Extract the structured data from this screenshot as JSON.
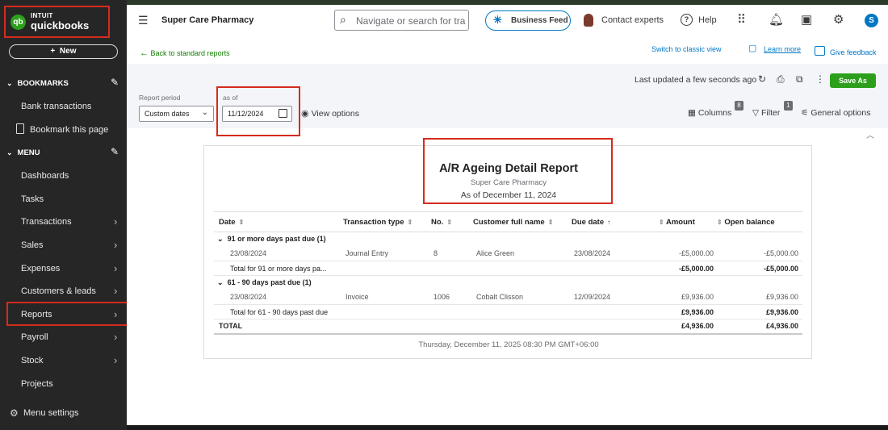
{
  "brand": {
    "intuit": "INTUIT",
    "product": "quickbooks",
    "accent": "#2ca01c",
    "highlight": "#d52b1e"
  },
  "sidebar": {
    "new_label": "New",
    "bookmarks_header": "BOOKMARKS",
    "bookmarks": [
      {
        "label": "Bank transactions"
      },
      {
        "label": "Bookmark this page"
      }
    ],
    "menu_header": "MENU",
    "items": [
      {
        "label": "Dashboards",
        "has_arrow": false
      },
      {
        "label": "Tasks",
        "has_arrow": false
      },
      {
        "label": "Transactions",
        "has_arrow": true
      },
      {
        "label": "Sales",
        "has_arrow": true
      },
      {
        "label": "Expenses",
        "has_arrow": true
      },
      {
        "label": "Customers & leads",
        "has_arrow": true
      },
      {
        "label": "Reports",
        "has_arrow": true
      },
      {
        "label": "Payroll",
        "has_arrow": true
      },
      {
        "label": "Stock",
        "has_arrow": true
      },
      {
        "label": "Projects",
        "has_arrow": false
      }
    ],
    "settings_label": "Menu settings"
  },
  "topbar": {
    "company": "Super Care Pharmacy",
    "search_placeholder": "Navigate or search for transactions",
    "business_feed": "Business Feed",
    "contact_experts": "Contact experts",
    "help": "Help",
    "user_initial": "S"
  },
  "links": {
    "back": "Back to standard reports",
    "classic": "Switch to classic view",
    "learn_more": "Learn more",
    "feedback": "Give feedback"
  },
  "options": {
    "last_updated": "Last updated a few seconds ago",
    "save_as": "Save As",
    "report_period_label": "Report period",
    "report_period_value": "Custom dates",
    "as_of_label": "as of",
    "as_of_value": "11/12/2024",
    "view_options": "View options",
    "columns": "Columns",
    "columns_badge": "8",
    "filter": "Filter",
    "filter_badge": "1",
    "general_options": "General options"
  },
  "report": {
    "title": "A/R Ageing Detail Report",
    "company": "Super Care Pharmacy",
    "as_of": "As of December 11, 2024",
    "columns": [
      "Date",
      "Transaction type",
      "No.",
      "Customer full name",
      "Due date",
      "Amount",
      "Open balance"
    ],
    "groups": [
      {
        "name": "91 or more days past due (1)",
        "rows": [
          {
            "date": "23/08/2024",
            "type": "Journal Entry",
            "no": "8",
            "customer": "Alice Green",
            "due": "23/08/2024",
            "amount": "-£5,000.00",
            "balance": "-£5,000.00"
          }
        ],
        "total_label": "Total for 91 or more days pa...",
        "total_amount": "-£5,000.00",
        "total_balance": "-£5,000.00"
      },
      {
        "name": "61 - 90 days past due (1)",
        "rows": [
          {
            "date": "23/08/2024",
            "type": "Invoice",
            "no": "1006",
            "customer": "Cobalt Clisson",
            "due": "12/09/2024",
            "amount": "£9,936.00",
            "balance": "£9,936.00"
          }
        ],
        "total_label": "Total for 61 - 90 days past due",
        "total_amount": "£9,936.00",
        "total_balance": "£9,936.00"
      }
    ],
    "grand_total_label": "TOTAL",
    "grand_total_amount": "£4,936.00",
    "grand_total_balance": "£4,936.00",
    "footer": "Thursday, December 11, 2025 08:30 PM GMT+06:00"
  }
}
